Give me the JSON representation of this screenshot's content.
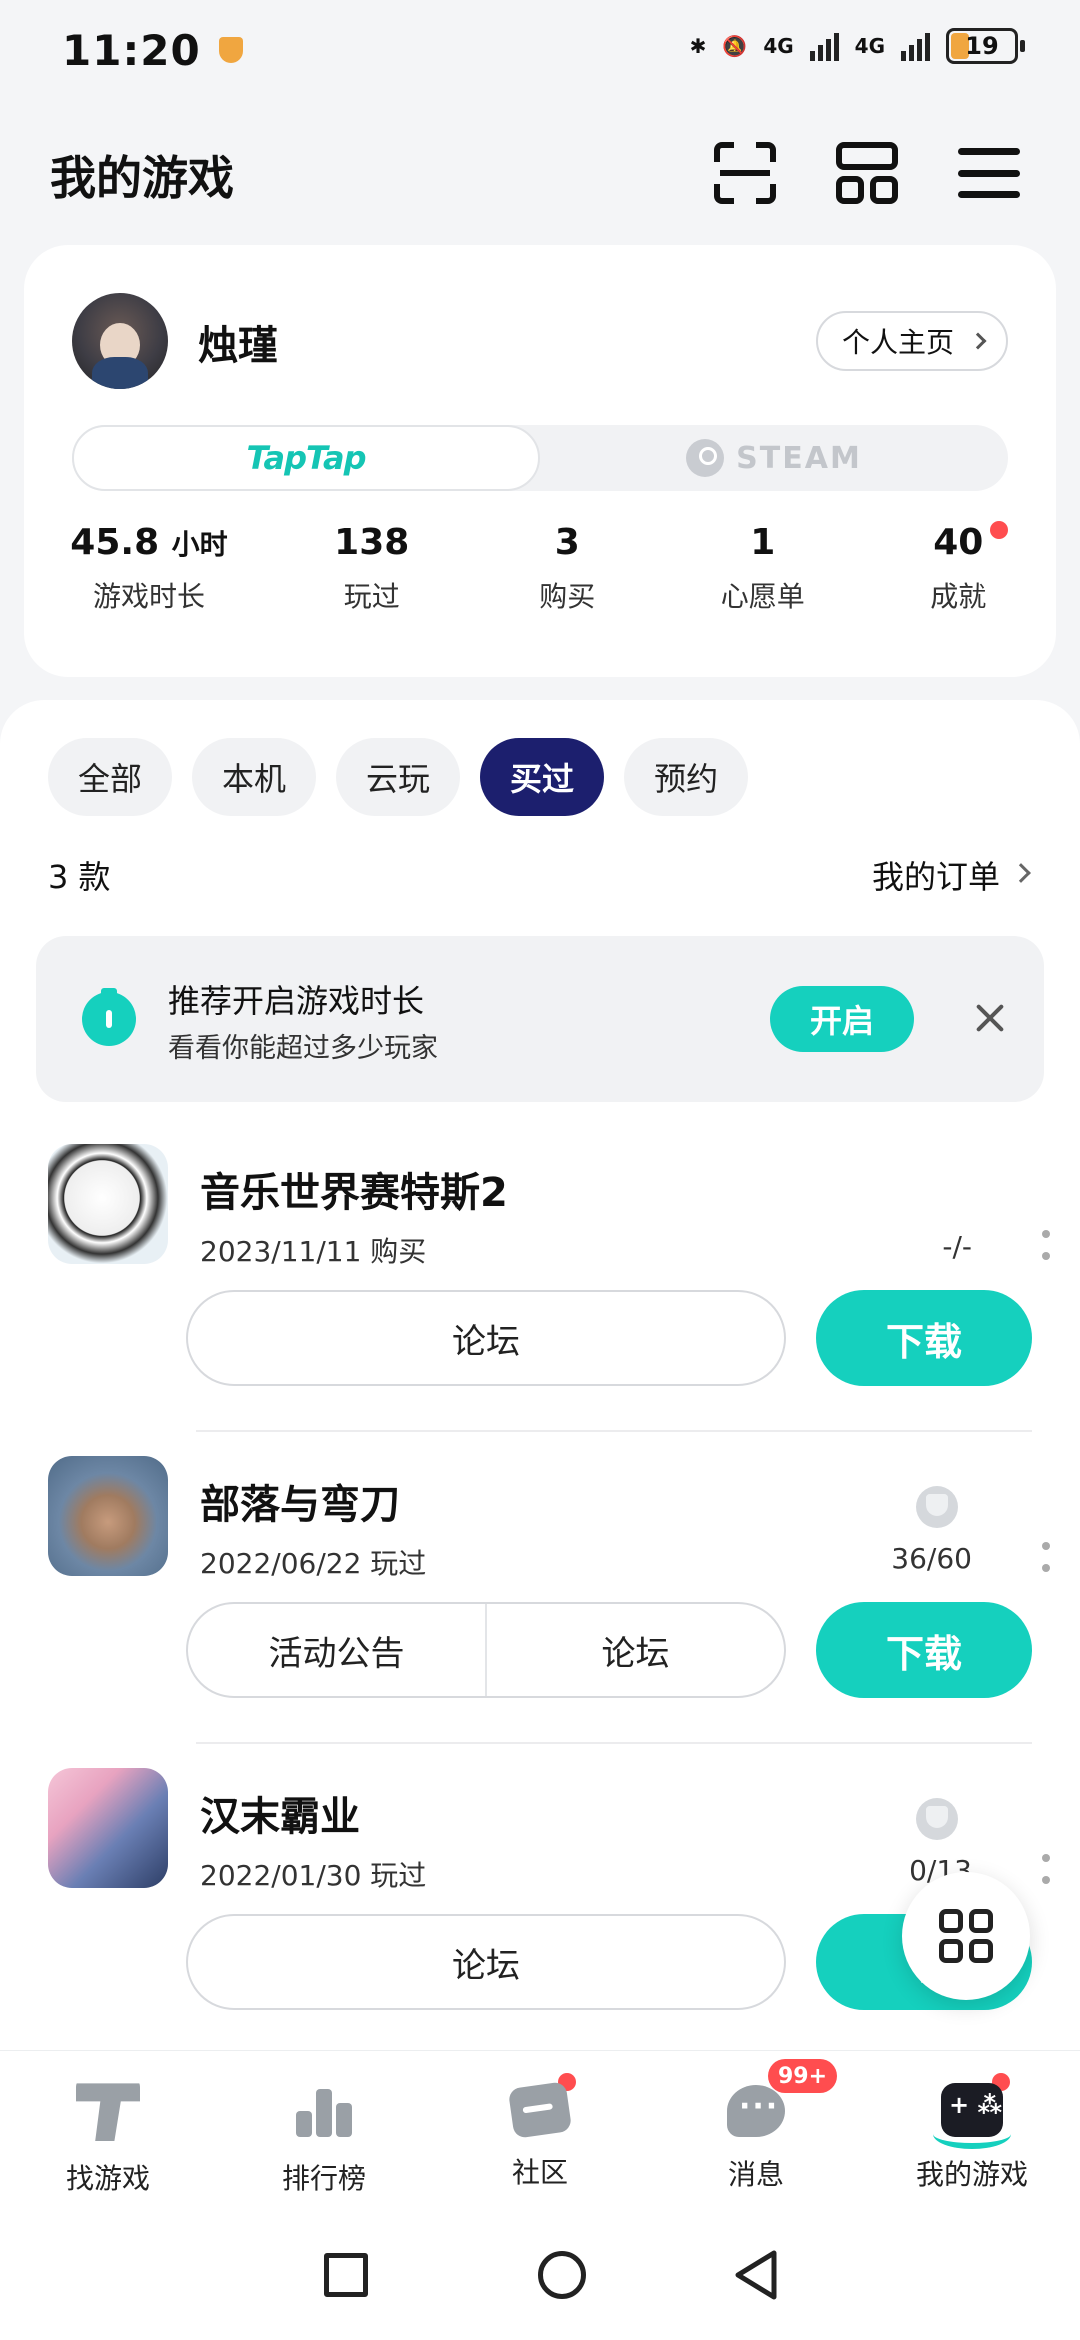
{
  "status_bar": {
    "time": "11:20",
    "network_1": "4G",
    "network_2": "4G",
    "battery": "19"
  },
  "header": {
    "title": "我的游戏",
    "scan_icon": "scan-icon",
    "grid_icon": "layout-icon",
    "menu_icon": "menu-icon"
  },
  "profile": {
    "username": "烛瑾",
    "homepage_label": "个人主页",
    "platforms": {
      "taptap": "TapTap",
      "steam": "STEAM",
      "active": "taptap"
    },
    "stats": [
      {
        "value": "45.8",
        "unit": "小时",
        "label": "游戏时长"
      },
      {
        "value": "138",
        "label": "玩过"
      },
      {
        "value": "3",
        "label": "购买"
      },
      {
        "value": "1",
        "label": "心愿单"
      },
      {
        "value": "40",
        "label": "成就",
        "has_dot": true
      }
    ]
  },
  "filters": {
    "items": [
      "全部",
      "本机",
      "云玩",
      "买过",
      "预约"
    ],
    "active": "买过"
  },
  "list_header": {
    "count": "3 款",
    "orders_link": "我的订单"
  },
  "banner": {
    "title": "推荐开启游戏时长",
    "subtitle": "看看你能超过多少玩家",
    "button": "开启"
  },
  "games": [
    {
      "title": "音乐世界赛特斯2",
      "subtitle": "2023/11/11 购买",
      "progress": "-/-",
      "buttons": [
        "论坛"
      ],
      "download": "下载"
    },
    {
      "title": "部落与弯刀",
      "subtitle": "2022/06/22 玩过",
      "progress": "36/60",
      "buttons": [
        "活动公告",
        "论坛"
      ],
      "download": "下载"
    },
    {
      "title": "汉末霸业",
      "subtitle": "2022/01/30 玩过",
      "progress": "0/13",
      "buttons": [
        "论坛"
      ],
      "download": "下"
    }
  ],
  "bottom_nav": [
    {
      "label": "找游戏"
    },
    {
      "label": "排行榜"
    },
    {
      "label": "社区",
      "has_dot": true
    },
    {
      "label": "消息",
      "badge": "99+"
    },
    {
      "label": "我的游戏",
      "has_dot": true,
      "active": true
    }
  ],
  "colors": {
    "accent": "#15d0be",
    "active_chip": "#1c1f6e",
    "badge_red": "#ff4d4f"
  }
}
